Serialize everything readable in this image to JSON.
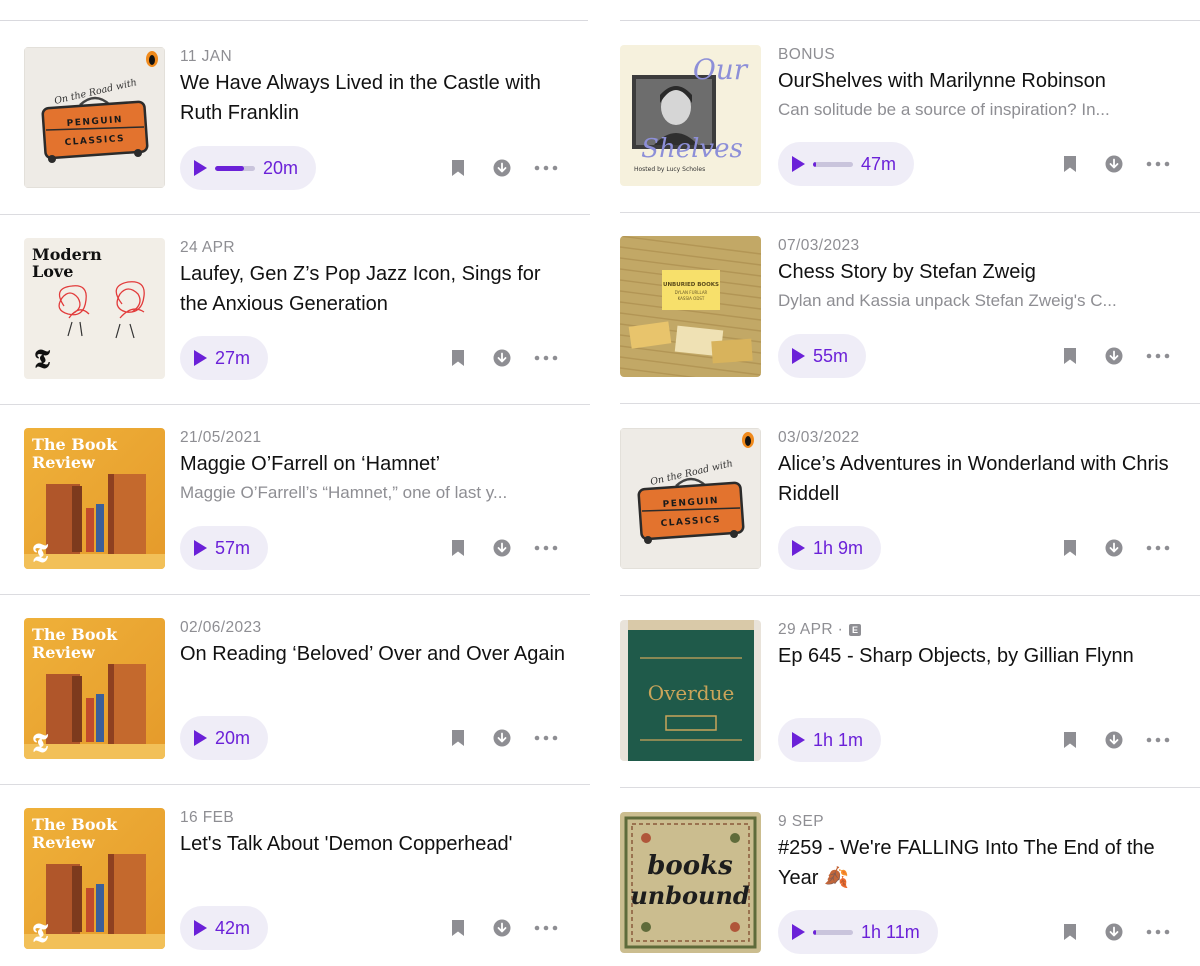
{
  "colors": {
    "accent": "#6b21d8",
    "pill": "#efedf7",
    "muted": "#8e8e93"
  },
  "left": [
    {
      "date": "11 JAN",
      "title": "We Have Always Lived in the Castle with Ruth Franklin",
      "duration": "20m",
      "progress": 0.72,
      "art": "penguin",
      "art_text": {
        "script": "On the Road with",
        "line1": "PENGUIN",
        "line2": "CLASSICS"
      }
    },
    {
      "date": "24 APR",
      "title": "Laufey, Gen Z’s Pop Jazz Icon, Sings for the Anxious Generation",
      "duration": "27m",
      "art": "modernlove",
      "art_text": {
        "line1": "Modern",
        "line2": "Love"
      }
    },
    {
      "date": "21/05/2021",
      "title": "Maggie O’Farrell on ‘Hamnet’",
      "desc": "Maggie O’Farrell’s “Hamnet,” one of last y...",
      "duration": "57m",
      "art": "bookreview",
      "art_text": {
        "line1": "The Book",
        "line2": "Review"
      }
    },
    {
      "date": "02/06/2023",
      "title": "On Reading ‘Beloved’ Over and Over Again",
      "duration": "20m",
      "art": "bookreview",
      "art_text": {
        "line1": "The Book",
        "line2": "Review"
      }
    },
    {
      "date": "16 FEB",
      "title": "Let's Talk About 'Demon Copperhead'",
      "duration": "42m",
      "art": "bookreview",
      "art_text": {
        "line1": "The Book",
        "line2": "Review"
      }
    }
  ],
  "right": [
    {
      "date": "BONUS",
      "title": "OurShelves with Marilynne Robinson",
      "desc": "Can solitude be a source of inspiration? In...",
      "duration": "47m",
      "progress": 0.06,
      "art": "ourshelves",
      "art_text": {
        "line1": "Our",
        "line2": "Shelves",
        "host": "Hosted by Lucy Scholes"
      }
    },
    {
      "date": "07/03/2023",
      "title": "Chess Story by Stefan Zweig",
      "desc": "Dylan and Kassia unpack Stefan Zweig's C...",
      "duration": "55m",
      "art": "unburied",
      "art_text": {
        "line1": "UNBURIED BOOKS",
        "line2": "DYLAN FURLLAR",
        "line3": "KASSIA ODST"
      }
    },
    {
      "date": "03/03/2022",
      "title": "Alice’s Adventures in Wonderland with Chris Riddell",
      "duration": "1h 9m",
      "art": "penguin",
      "art_text": {
        "script": "On the Road with",
        "line1": "PENGUIN",
        "line2": "CLASSICS"
      }
    },
    {
      "date": "29 APR ·",
      "explicit": "E",
      "title": "Ep 645 - Sharp Objects, by Gillian Flynn",
      "duration": "1h 1m",
      "art": "overdue",
      "art_text": {
        "line1": "Overdue"
      }
    },
    {
      "date": "9 SEP",
      "title": "#259 - We're FALLING Into The End of the Year 🍂",
      "duration": "1h 11m",
      "progress": 0.06,
      "art": "booksunbound",
      "art_text": {
        "line1": "books",
        "line2": "unbound"
      }
    }
  ]
}
